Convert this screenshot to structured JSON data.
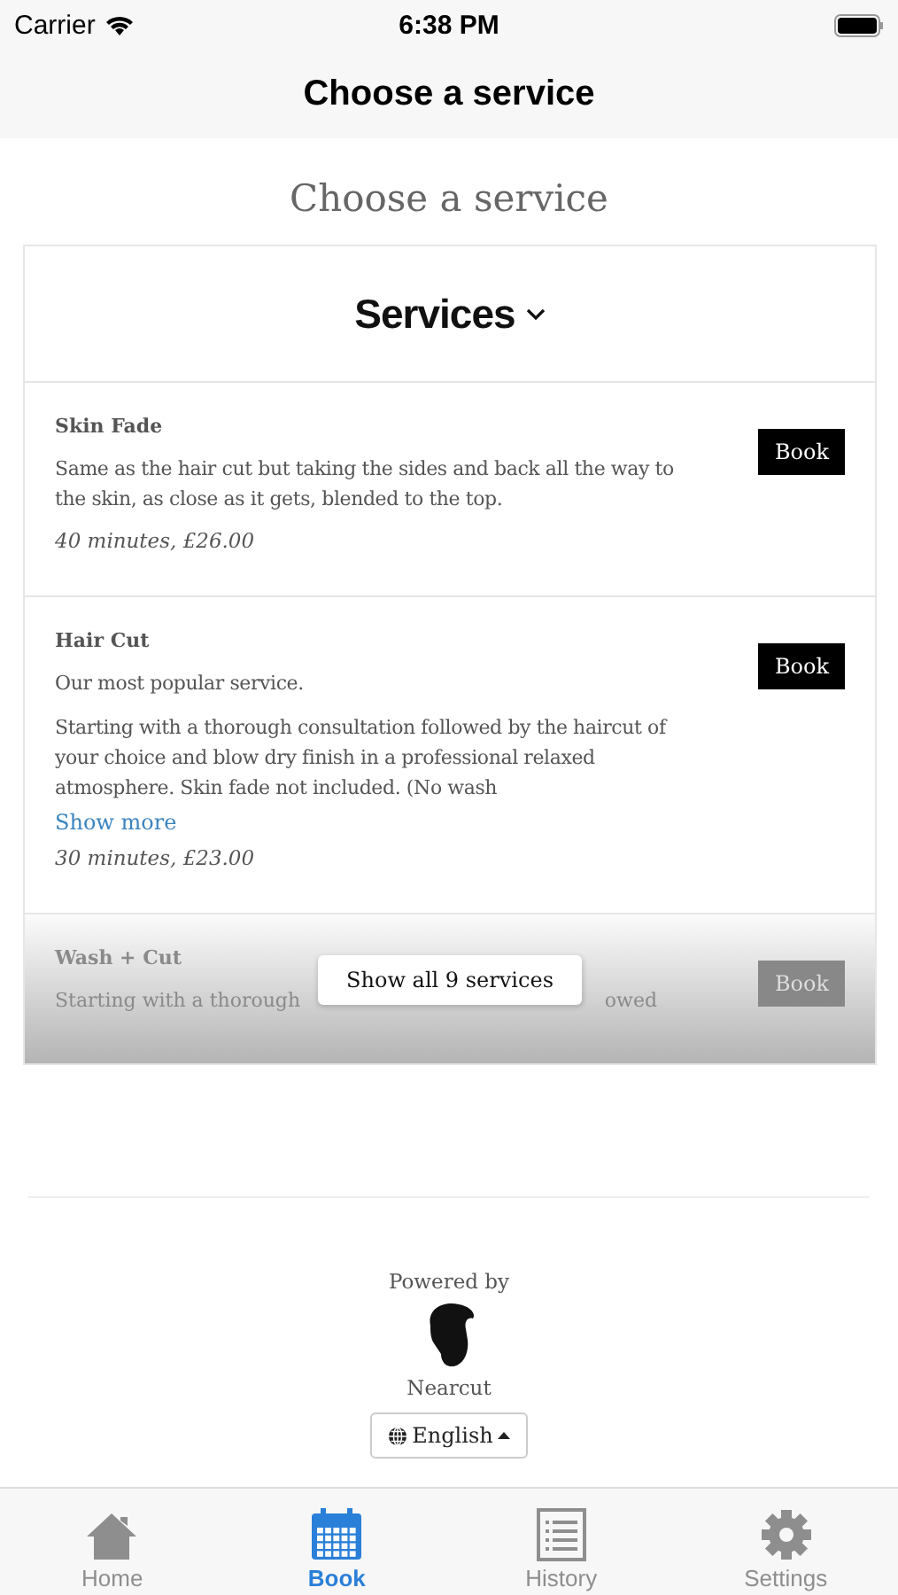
{
  "status_bar": {
    "carrier": "Carrier",
    "time": "6:38 PM"
  },
  "nav_bar": {
    "title": "Choose a service"
  },
  "heading": "Choose a service",
  "services_card": {
    "title": "Services",
    "items": [
      {
        "name": "Skin Fade",
        "paragraphs": [
          "Same as the hair cut but taking the sides and back all the way to the skin, as close as it gets, blended to the top."
        ],
        "details": "40 minutes, £26.00",
        "button": "Book",
        "faded": false
      },
      {
        "name": "Hair Cut",
        "paragraphs": [
          "Our most popular service.",
          "Starting with a thorough consultation followed by the haircut of your choice and blow dry finish in a professional relaxed atmosphere. Skin fade not included. (No wash"
        ],
        "show_more": "Show more",
        "details": "30 minutes, £23.00",
        "button": "Book",
        "faded": false
      },
      {
        "name": "Wash + Cut",
        "partial_line": [
          "Starting with a thorough",
          "owed"
        ],
        "button": "Book",
        "faded": true
      }
    ],
    "show_all": "Show all 9 services"
  },
  "footer": {
    "powered_by": "Powered by",
    "brand": "Nearcut",
    "language": "English"
  },
  "tab_bar": [
    {
      "label": "Home",
      "selected": false
    },
    {
      "label": "Book",
      "selected": true
    },
    {
      "label": "History",
      "selected": false
    },
    {
      "label": "Settings",
      "selected": false
    }
  ]
}
